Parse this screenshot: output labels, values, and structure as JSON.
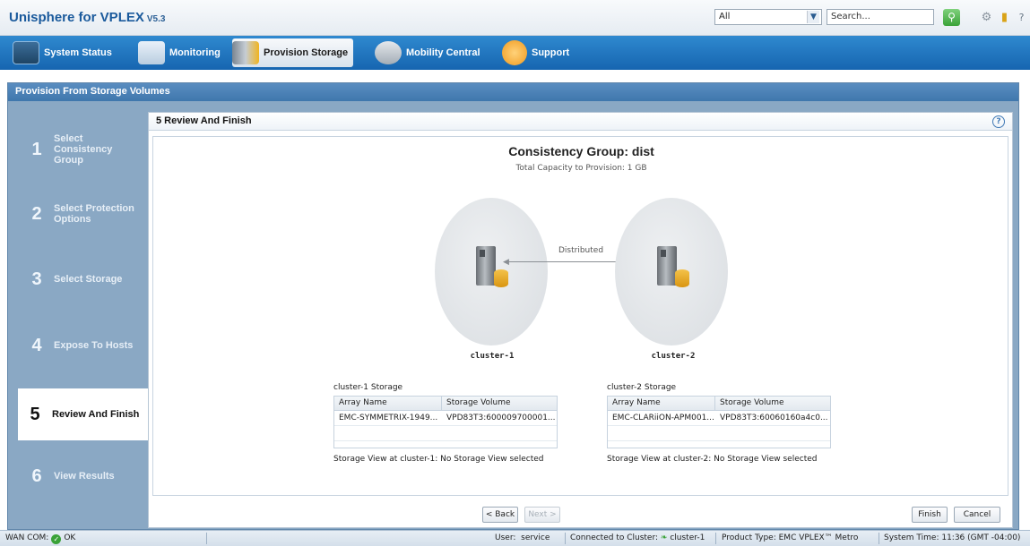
{
  "app": {
    "title": "Unisphere for VPLEX",
    "version": "V5.3"
  },
  "toolbar": {
    "scope_value": "All",
    "search_placeholder": "Search..."
  },
  "nav": {
    "items": [
      {
        "label": "System Status",
        "icon": "monitor-chart-icon"
      },
      {
        "label": "Monitoring",
        "icon": "waveform-icon"
      },
      {
        "label": "Provision Storage",
        "icon": "storage-folder-icon",
        "active": true
      },
      {
        "label": "Mobility Central",
        "icon": "database-arrow-icon"
      },
      {
        "label": "Support",
        "icon": "question-circle-icon"
      }
    ]
  },
  "wizard": {
    "panel_title": "Provision From Storage Volumes",
    "steps": [
      {
        "number": "1",
        "label": "Select Consistency Group"
      },
      {
        "number": "2",
        "label": "Select Protection Options"
      },
      {
        "number": "3",
        "label": "Select Storage"
      },
      {
        "number": "4",
        "label": "Expose To Hosts"
      },
      {
        "number": "5",
        "label": "Review And Finish",
        "current": true
      },
      {
        "number": "6",
        "label": "View Results"
      }
    ],
    "step_header": "5  Review And Finish",
    "cg_title": "Consistency Group: dist",
    "cg_subtitle": "Total Capacity to Provision: 1 GB",
    "link_label": "Distributed",
    "cluster1": "cluster-1",
    "cluster2": "cluster-2",
    "cluster1_storage": {
      "title": "cluster-1 Storage",
      "col_array": "Array Name",
      "col_volume": "Storage Volume",
      "array": "EMC-SYMMETRIX-1949...",
      "volume": "VPD83T3:600009700001...",
      "view": "Storage View at cluster-1: No Storage View selected"
    },
    "cluster2_storage": {
      "title": "cluster-2 Storage",
      "col_array": "Array Name",
      "col_volume": "Storage Volume",
      "array": "EMC-CLARiiON-APM001...",
      "volume": "VPD83T3:60060160a4c0...",
      "view": "Storage View at cluster-2: No Storage View selected"
    },
    "buttons": {
      "back": "< Back",
      "next": "Next >",
      "finish": "Finish",
      "cancel": "Cancel"
    }
  },
  "status": {
    "wan_label": "WAN COM:",
    "wan_value": "OK",
    "user_label": "User:",
    "user_value": "service",
    "connected_label": "Connected to Cluster:",
    "connected_value": "cluster-1",
    "product_label": "Product Type:",
    "product_value": "EMC VPLEX™ Metro",
    "time": "System Time: 11:36 (GMT -04:00)"
  },
  "colors": {
    "brand": "#1a5a9c",
    "nav": "#1f72bd",
    "panel": "#8aa8c4",
    "ok": "#3aa238"
  }
}
